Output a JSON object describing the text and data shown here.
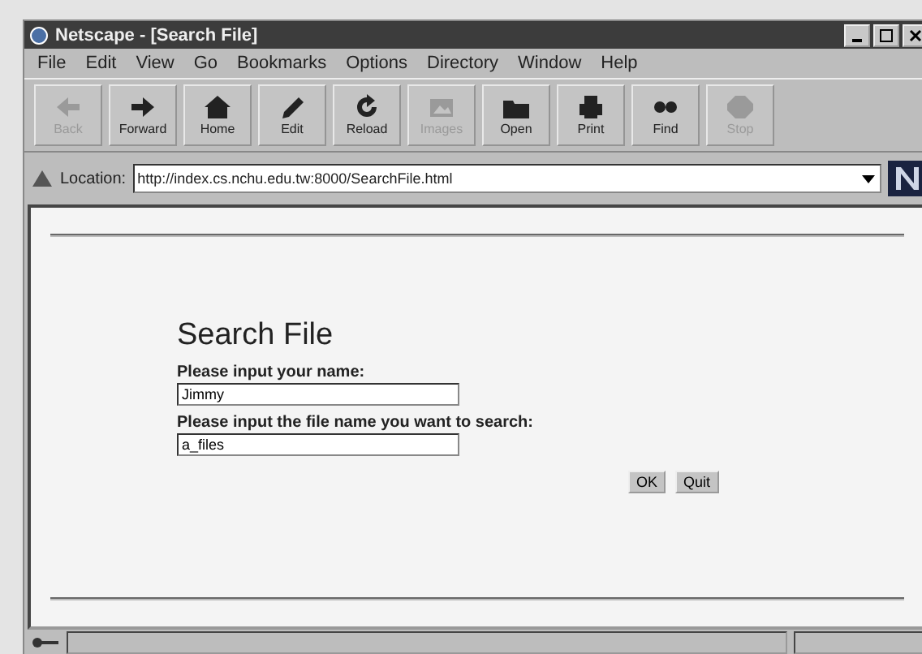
{
  "window": {
    "title": "Netscape - [Search File]"
  },
  "menu": [
    "File",
    "Edit",
    "View",
    "Go",
    "Bookmarks",
    "Options",
    "Directory",
    "Window",
    "Help"
  ],
  "toolbar": [
    {
      "kind": "back",
      "label": "Back",
      "disabled": true
    },
    {
      "kind": "forward",
      "label": "Forward",
      "disabled": false
    },
    {
      "kind": "home",
      "label": "Home",
      "disabled": false
    },
    {
      "kind": "edit",
      "label": "Edit",
      "disabled": false
    },
    {
      "kind": "reload",
      "label": "Reload",
      "disabled": false
    },
    {
      "kind": "images",
      "label": "Images",
      "disabled": true
    },
    {
      "kind": "open",
      "label": "Open",
      "disabled": false
    },
    {
      "kind": "print",
      "label": "Print",
      "disabled": false
    },
    {
      "kind": "find",
      "label": "Find",
      "disabled": false
    },
    {
      "kind": "stop",
      "label": "Stop",
      "disabled": true
    }
  ],
  "location": {
    "label": "Location:",
    "url": "http://index.cs.nchu.edu.tw:8000/SearchFile.html"
  },
  "page": {
    "heading": "Search File",
    "fields": [
      {
        "label": "Please input your name:",
        "value": "Jimmy"
      },
      {
        "label": "Please input the file name you want to search:",
        "value": "a_files"
      }
    ],
    "buttons": [
      "OK",
      "Quit"
    ]
  }
}
